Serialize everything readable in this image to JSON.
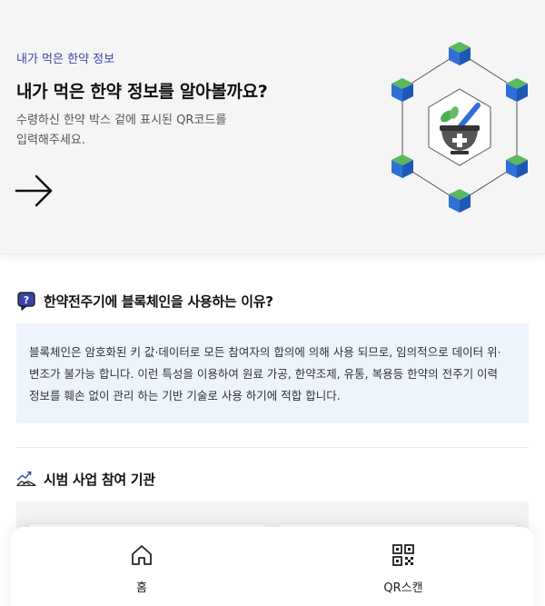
{
  "hero": {
    "eyebrow": "내가 먹은 한약 정보",
    "title": "내가 먹은 한약 정보를 알아볼까요?",
    "description_line1": "수령하신 한약 박스 겉에 표시된 QR코드를",
    "description_line2": "입력해주세요.",
    "arrow_icon": "arrow-right-icon",
    "illustration_icon": "blockchain-herbal-mortar-icon"
  },
  "why_section": {
    "icon": "question-chat-icon",
    "title": "한약전주기에 블록체인을 사용하는 이유?",
    "body_line1": "블록체인은 암호화된 키 값·데이터로 모든 참여자의 합의에 의해 사용 되므로, 임의적으로 데이터 위·",
    "body_line2": "변조가 불가능 합니다. 이런 특성을 이용하여 원료 가공, 한약조제, 유통, 복용등 한약의 전주기 이력",
    "body_line3": "정보를 훼손 없이 관리 하는 기반 기술로 사용 하기에 적합 합니다."
  },
  "partners_section": {
    "icon": "handshake-chart-icon",
    "title": "시범 사업 참여 기관"
  },
  "bottom_nav": {
    "home_label": "홈",
    "home_icon": "home-icon",
    "qr_label": "QR스캔",
    "qr_icon": "qr-code-icon"
  },
  "colors": {
    "accent": "#3b43a8",
    "info_bg": "#eef4fb",
    "cube_green": "#4caf50",
    "cube_blue": "#2f6fd6"
  }
}
